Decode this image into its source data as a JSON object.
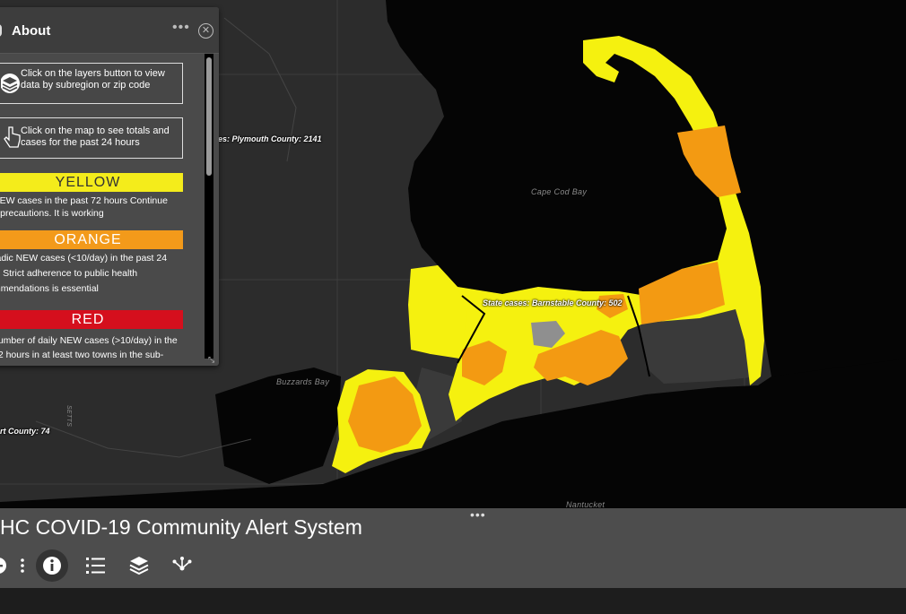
{
  "map": {
    "place_labels": [
      "Cape Cod Bay",
      "Buzzards Bay",
      "Nantucket"
    ],
    "county_labels": [
      "es: Plymouth County: 2141",
      "State cases: Barnstable County: 502",
      "rt County: 74"
    ],
    "fragment_label": "SETTS",
    "colors": {
      "yellow": "#f5f10f",
      "orange": "#f39a12",
      "gray": "#8f8f8f",
      "land": "#2c2c2c",
      "water": "#050505"
    }
  },
  "about": {
    "title": "About",
    "tips": [
      {
        "icon": "layers-icon",
        "text": "Click on the layers button to view data by subregion or zip code"
      },
      {
        "icon": "cursor-click-icon",
        "text": "Click on the map to see totals and cases for the past 24 hours"
      }
    ],
    "levels": {
      "yellow": {
        "label": "YELLOW",
        "color": "#f4ec1b",
        "lines": [
          "NEW cases in the past 72 hours  Continue",
          "y precautions.  It is working"
        ]
      },
      "orange": {
        "label": "ORANGE",
        "color": "#f39a1a",
        "lines": [
          "radic NEW cases (<10/day) in the past 24",
          "s. Strict adherence to public health",
          "mmendations is essential"
        ]
      },
      "red": {
        "label": "RED",
        "color": "#d50f1d",
        "lines": [
          "number of daily NEW cases (>10/day) in the",
          "72 hours in at least two towns in the sub-"
        ]
      }
    }
  },
  "toolbar": {
    "title": "HC COVID-19 Community Alert System",
    "tools": [
      "zoom-out-icon",
      "more-vertical-icon",
      "info-icon",
      "legend-list-icon",
      "layers-icon",
      "share-icon"
    ]
  }
}
